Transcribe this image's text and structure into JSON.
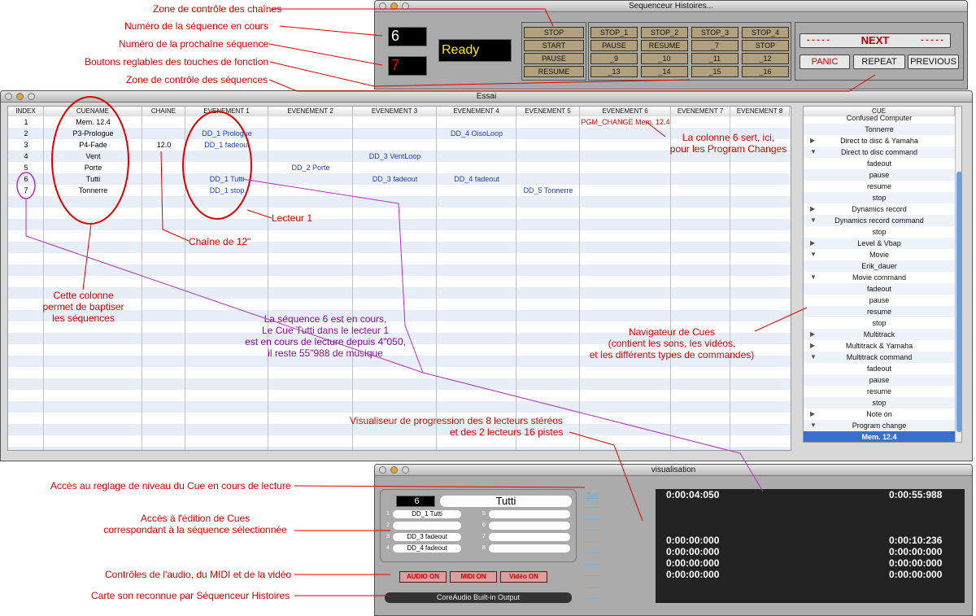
{
  "win_top": {
    "title": "Sequenceur Histoires...",
    "current_seq": "6",
    "next_seq": "7",
    "status": "Ready",
    "buttons_left": [
      "STOP",
      "START",
      "PAUSE",
      "RESUME"
    ],
    "fkeys": [
      "STOP_1",
      "STOP_2",
      "STOP_3",
      "STOP_4",
      "PAUSE",
      "RESUME",
      "_7",
      "STOP",
      "_9",
      "_10",
      "_11",
      "_12",
      "_13",
      "_14",
      "_15",
      "_16"
    ],
    "next": "NEXT",
    "next_dashes": "- - - - -",
    "panic": "PANIC",
    "repeat": "REPEAT",
    "previous": "PREVIOUS"
  },
  "win_essai": {
    "title": "Essai",
    "headers": [
      "INDEX",
      "CUENAME",
      "CHAINE",
      "EVENEMENT 1",
      "EVENEMENT 2",
      "EVENEMENT 3",
      "EVENEMENT 4",
      "EVENEMENT 5",
      "EVENEMENT 6",
      "EVENEMENT 7",
      "EVENEMENT 8"
    ],
    "rows": [
      {
        "index": "1",
        "cuename": "Mem. 12.4",
        "chaine": "",
        "e1": "",
        "e2": "",
        "e3": "",
        "e4": "",
        "e5": "",
        "e6": "PGM_CHANGE Mem. 12.4"
      },
      {
        "index": "2",
        "cuename": "P3-Prologue",
        "chaine": "",
        "e1": "DD_1 Prologue",
        "e2": "",
        "e3": "",
        "e4": "DD_4 OisoLoop",
        "e5": "",
        "e6": ""
      },
      {
        "index": "3",
        "cuename": "P4-Fade",
        "chaine": "12.0",
        "e1": "DD_1 fadeout",
        "e2": "",
        "e3": "",
        "e4": "",
        "e5": "",
        "e6": ""
      },
      {
        "index": "4",
        "cuename": "Vent",
        "chaine": "",
        "e1": "",
        "e2": "",
        "e3": "DD_3 VentLoop",
        "e4": "",
        "e5": "",
        "e6": ""
      },
      {
        "index": "5",
        "cuename": "Porte",
        "chaine": "",
        "e1": "",
        "e2": "DD_2 Porte",
        "e3": "",
        "e4": "",
        "e5": "",
        "e6": ""
      },
      {
        "index": "6",
        "cuename": "Tutti",
        "chaine": "",
        "e1": "DD_1 Tutti",
        "e2": "",
        "e3": "DD_3 fadeout",
        "e4": "DD_4 fadeout",
        "e5": "",
        "e6": ""
      },
      {
        "index": "7",
        "cuename": "Tonnerre",
        "chaine": "",
        "e1": "DD_1 stop",
        "e2": "",
        "e3": "",
        "e4": "",
        "e5": "DD_5 Tonnerre",
        "e6": ""
      }
    ],
    "nav_header": "CUE",
    "nav": [
      {
        "t": "",
        "l": "Confused Computer"
      },
      {
        "t": "",
        "l": "Tonnerre"
      },
      {
        "t": "▶",
        "l": "Direct to disc & Yamaha"
      },
      {
        "t": "▼",
        "l": "Direct to disc command"
      },
      {
        "t": "",
        "l": "fadeout"
      },
      {
        "t": "",
        "l": "pause"
      },
      {
        "t": "",
        "l": "resume"
      },
      {
        "t": "",
        "l": "stop"
      },
      {
        "t": "▶",
        "l": "Dynamics record"
      },
      {
        "t": "▼",
        "l": "Dynamics record command"
      },
      {
        "t": "",
        "l": "stop"
      },
      {
        "t": "▶",
        "l": "Level & Vbap"
      },
      {
        "t": "▼",
        "l": "Movie"
      },
      {
        "t": "",
        "l": "Erik_dauer"
      },
      {
        "t": "▼",
        "l": "Movie command"
      },
      {
        "t": "",
        "l": "fadeout"
      },
      {
        "t": "",
        "l": "pause"
      },
      {
        "t": "",
        "l": "resume"
      },
      {
        "t": "",
        "l": "stop"
      },
      {
        "t": "▶",
        "l": "Multitrack"
      },
      {
        "t": "▶",
        "l": "Multitrack & Yamaha"
      },
      {
        "t": "▼",
        "l": "Multitrack command"
      },
      {
        "t": "",
        "l": "fadeout"
      },
      {
        "t": "",
        "l": "pause"
      },
      {
        "t": "",
        "l": "resume"
      },
      {
        "t": "",
        "l": "stop"
      },
      {
        "t": "▶",
        "l": "Note on"
      },
      {
        "t": "▼",
        "l": "Program change"
      },
      {
        "t": "",
        "l": "Mem. 12.4"
      }
    ]
  },
  "win_vis": {
    "title": "visualisation",
    "seq_num": "6",
    "seq_name": "Tutti",
    "slots": [
      {
        "n": "1",
        "v": "DD_1 Tutti"
      },
      {
        "n": "2",
        "v": ""
      },
      {
        "n": "3",
        "v": "DD_3 fadeout"
      },
      {
        "n": "4",
        "v": "DD_4 fadeout"
      },
      {
        "n": "5",
        "v": ""
      },
      {
        "n": "6",
        "v": ""
      },
      {
        "n": "7",
        "v": ""
      },
      {
        "n": "8",
        "v": ""
      }
    ],
    "audio": "AUDIO ON",
    "midi": "MIDI ON",
    "video": "Vidéo ON",
    "card": "CoreAudio Built-in Output",
    "link": "Tutti",
    "dashes": "--------",
    "timers": [
      {
        "a": "0:00:04:050",
        "b": "0:00:55:988"
      },
      {
        "a": "0:00:00:000",
        "b": "0:00:10:236"
      },
      {
        "a": "0:00:00:000",
        "b": "0:00:00:000"
      },
      {
        "a": "0:00:00:000",
        "b": "0:00:00:000"
      },
      {
        "a": "0:00:00:000",
        "b": "0:00:00:000"
      }
    ]
  },
  "ann": {
    "a1": "Zone de contrôle des chaînes",
    "a2": "Numéro de la séquence en cours",
    "a3": "Numéro de la prochaîne séquence",
    "a4": "Boutons reglables des touches de fonction",
    "a5": "Zone de contrôle des séquences",
    "a6": "La colonne 6 sert, ici,",
    "a7": "pour les Program Changes",
    "a8": "Lecteur 1",
    "a9": "Chaîne de 12\"",
    "a10": "Cette colonne",
    "a11": "permet de baptiser",
    "a12": "les séquences",
    "a13": "La séquence 6 est en cours,",
    "a14": "Le Cue Tutti dans le lecteur 1",
    "a15": "est en cours de lecture depuis 4\"050,",
    "a16": "il  reste 55\"988 de musique",
    "a17": "Navigateur de Cues",
    "a18": "(contient les sons, les vidéos,",
    "a19": "et les différents types de commandes)",
    "a20": "Visualiseur de progression des 8 lecteurs stéréos",
    "a21": "et des 2 lecteurs 16 pistes",
    "a22": "Accès au reglage de niveau du Cue en cours de lecture",
    "a23": "Accès à l'édition de Cues",
    "a24": "correspondant à la séquence sélectionnée",
    "a25": "Contrôles de l'audio, du MIDI et de la vidéo",
    "a26": "Carte son reconnue par Séquenceur Histoires"
  }
}
